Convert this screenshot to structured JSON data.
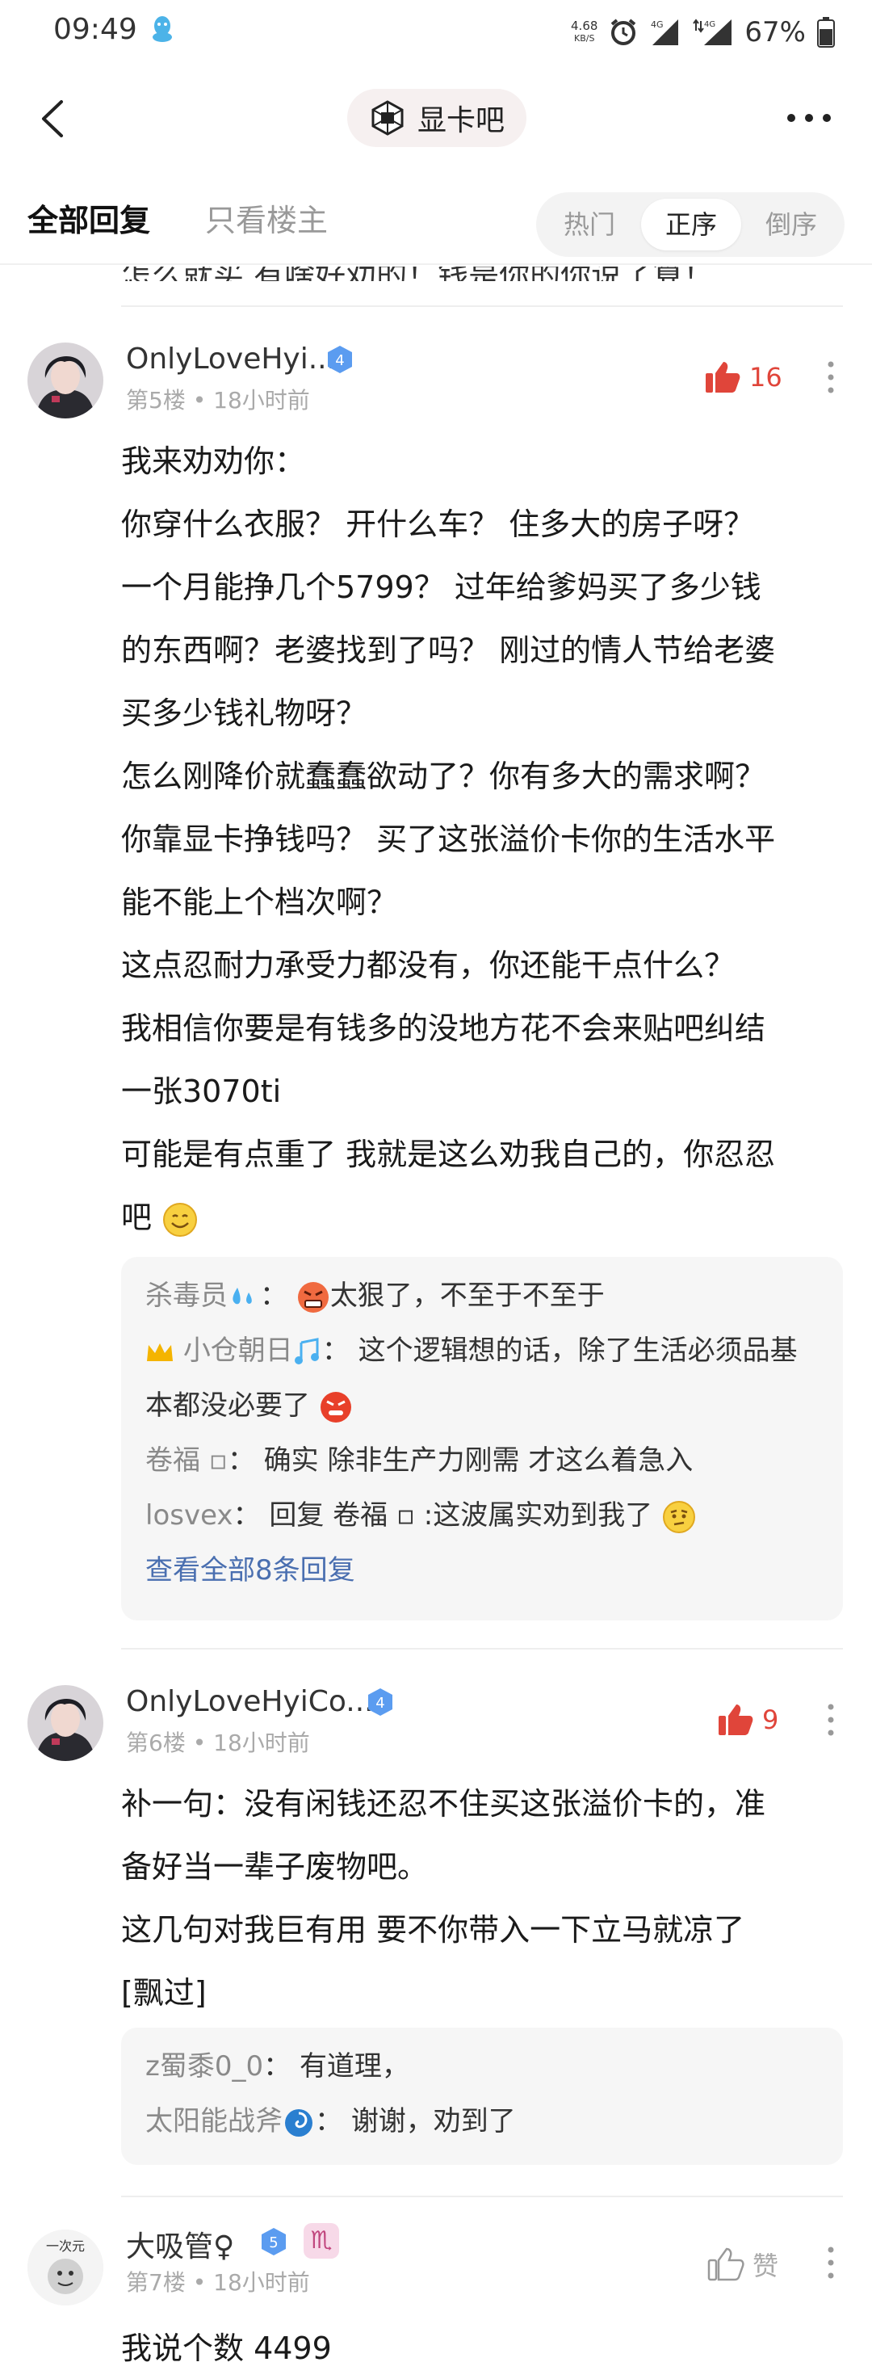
{
  "status_bar": {
    "time": "09:49",
    "net_speed_value": "4.68",
    "net_speed_unit": "KB/S",
    "net_type_1": "4G",
    "net_type_2": "4G",
    "battery": "67%"
  },
  "header": {
    "forum_name": "显卡吧"
  },
  "tabs": {
    "all_replies": "全部回复",
    "owner_only": "只看楼主",
    "sort_hot": "热门",
    "sort_asc": "正序",
    "sort_desc": "倒序"
  },
  "cutoff_line": "怎么就买 有啥好劝的！钱是你的你说了算！",
  "posts": [
    {
      "username": "OnlyLoveHyi...",
      "level": "4",
      "floor": "第5楼",
      "time": "18小时前",
      "likes": "16",
      "lines": [
        "我来劝劝你：",
        "你穿什么衣服？ 开什么车？ 住多大的房子呀？",
        "一个月能挣几个5799？ 过年给爹妈买了多少钱",
        "的东西啊？老婆找到了吗？ 刚过的情人节给老婆",
        "买多少钱礼物呀？",
        "怎么刚降价就蠢蠢欲动了？你有多大的需求啊？",
        "你靠显卡挣钱吗？ 买了这张溢价卡你的生活水平",
        "能不能上个档次啊？",
        "这点忍耐力承受力都没有，你还能干点什么？",
        "我相信你要是有钱多的没地方花不会来贴吧纠结",
        "一张3070ti",
        "可能是有点重了 我就是这么劝我自己的，你忍忍",
        "吧"
      ],
      "replies": [
        {
          "name": "杀毒员",
          "text": "太狠了，不至于不至于"
        },
        {
          "name": "小仓朝日",
          "text": "这个逻辑想的话，除了生活必须品基本都没必要了"
        },
        {
          "name": "卷福 ▫",
          "text": "确实 除非生产力刚需 才这么着急入"
        },
        {
          "name": "losvex",
          "text": "回复 卷福 ▫ :这波属实劝到我了"
        }
      ],
      "view_all": "查看全部8条回复"
    },
    {
      "username": "OnlyLoveHyiCo...",
      "level": "4",
      "floor": "第6楼",
      "time": "18小时前",
      "likes": "9",
      "lines": [
        "补一句：没有闲钱还忍不住买这张溢价卡的，准",
        "备好当一辈子废物吧。",
        "这几句对我巨有用 要不你带入一下立马就凉了",
        "[飘过]"
      ],
      "replies": [
        {
          "name": "z蜀黍0_0",
          "text": "有道理，"
        },
        {
          "name": "太阳能战斧",
          "text": "谢谢，劝到了"
        }
      ]
    },
    {
      "username": "大吸管♀",
      "level": "5",
      "zodiac": "♏",
      "avatar_text": "一次元",
      "floor": "第7楼",
      "time": "18小时前",
      "like_label": "赞",
      "lines": [
        "我说个数 4499"
      ]
    }
  ],
  "colors": {
    "like_red": "#e0453a",
    "link_blue": "#4a6fb0",
    "verified_blue": "#5b9cf0",
    "reply_bg": "#f6f6f6"
  }
}
